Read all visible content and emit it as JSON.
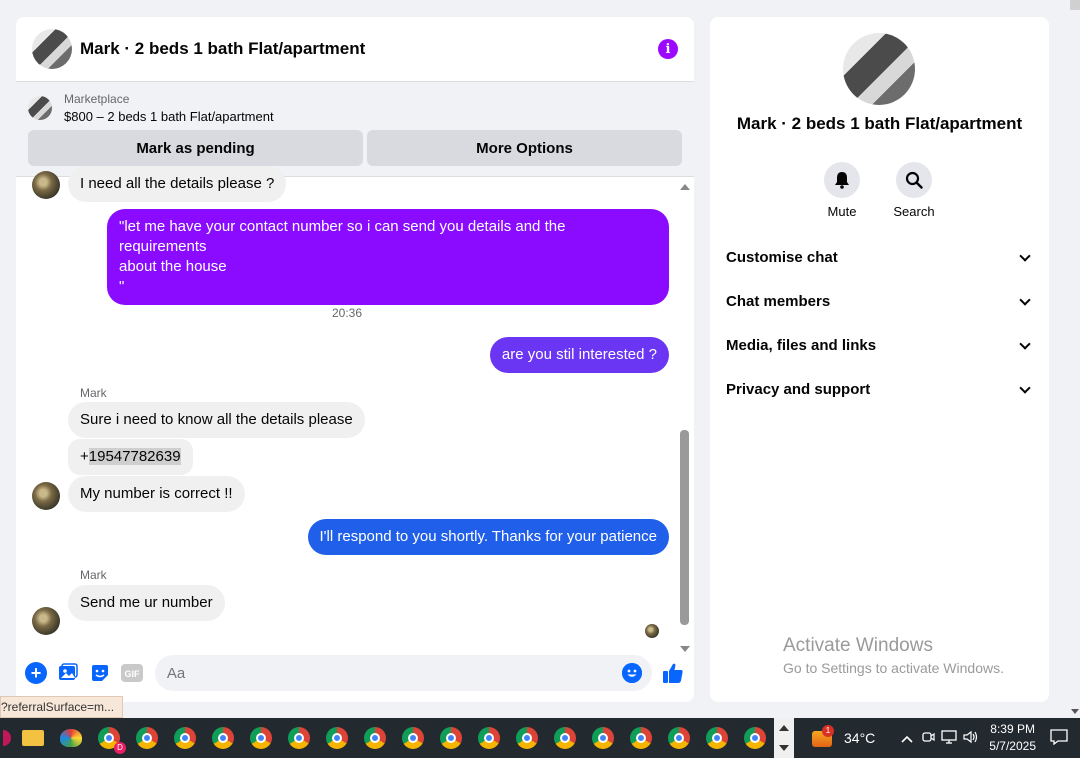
{
  "conversation": {
    "title": "Mark · 2 beds 1 bath Flat/apartment"
  },
  "marketplace": {
    "label": "Marketplace",
    "listing": "$800 – 2 beds 1 bath Flat/apartment",
    "mark_pending": "Mark as pending",
    "more_options": "More Options"
  },
  "messages": {
    "m1": "I need all the details please ?",
    "m2_line1": "\"let me have your contact number so i can send you details and the requirements",
    "m2_line2": "about the house",
    "m2_line3": "\"",
    "time1": "20:36",
    "m3": "are you stil interested ?",
    "sender1": "Mark",
    "m4": "Sure i need to know all the details please",
    "m5_prefix": "+",
    "m5_number": "19547782639",
    "m6": "My number is correct !!",
    "m7": "I'll respond to you shortly. Thanks for your patience",
    "sender2": "Mark",
    "m8": "Send me ur number"
  },
  "composer": {
    "placeholder": "Aa",
    "gif_label": "GIF"
  },
  "info_panel": {
    "title": "Mark · 2 beds 1 bath Flat/apartment",
    "mute": "Mute",
    "search": "Search",
    "sections": [
      "Customise chat",
      "Chat members",
      "Media, files and links",
      "Privacy and support"
    ]
  },
  "watermark": {
    "title": "Activate Windows",
    "subtitle": "Go to Settings to activate Windows."
  },
  "status_tip": "?referralSurface=m...",
  "taskbar": {
    "weather": "34°C",
    "weather_badge": "1",
    "time": "8:39 PM",
    "date": "5/7/2025",
    "chrome_badge": "D"
  },
  "colors": {
    "accent_purple": "#8a0bff",
    "accent_violet": "#6a35f3",
    "accent_blue": "#1f5fe9",
    "messenger_blue": "#0866ff"
  }
}
